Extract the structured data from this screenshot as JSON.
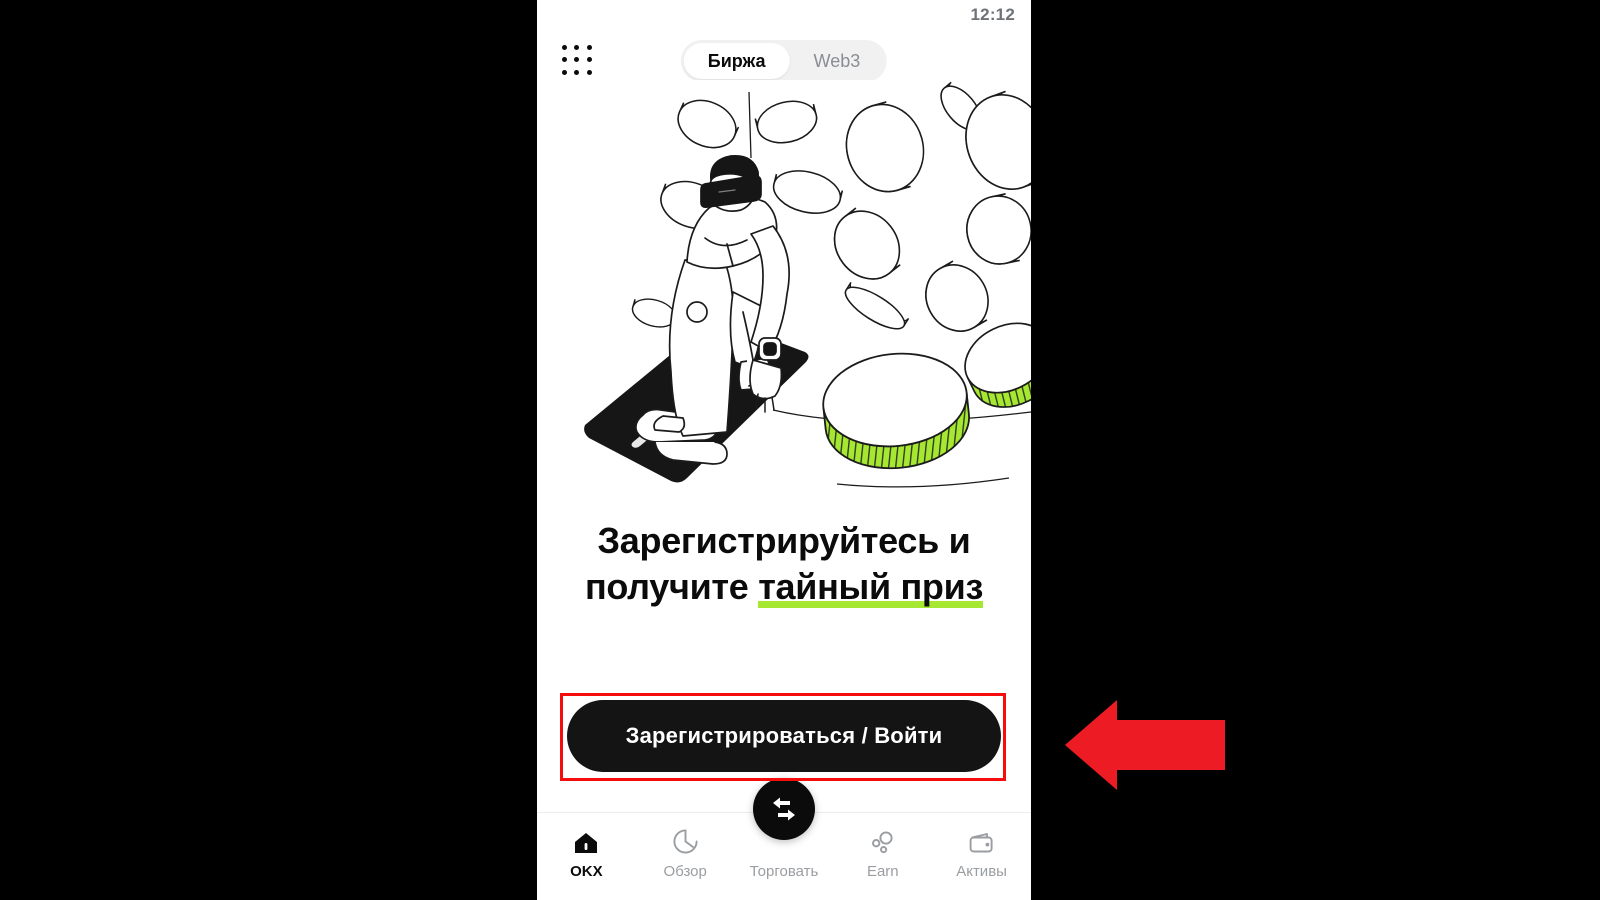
{
  "statusbar": {
    "time": "12:12"
  },
  "topbar": {
    "apps_icon": "grid-dots-icon",
    "segments": [
      {
        "label": "Биржа",
        "active": true
      },
      {
        "label": "Web3",
        "active": false
      }
    ]
  },
  "hero": {
    "illustration": "person-vr-headset-kneeling-on-phone-with-coins",
    "accent_color": "#a6e831",
    "phone_color": "#141414"
  },
  "headline": {
    "line1": "Зарегистрируйтесь и",
    "line2_plain": "получите ",
    "line2_highlight": "тайный приз",
    "highlight_color": "#a6e831"
  },
  "cta": {
    "label": "Зарегистрироваться / Войти",
    "background": "#141414",
    "text_color": "#ffffff"
  },
  "fab": {
    "icon": "swap-arrows-icon"
  },
  "tabbar": {
    "items": [
      {
        "label": "OKX",
        "icon": "home-icon",
        "active": true
      },
      {
        "label": "Обзор",
        "icon": "compass-icon",
        "active": false
      },
      {
        "label": "Торговать",
        "icon": "swap-icon",
        "active": false
      },
      {
        "label": "Earn",
        "icon": "bubbles-icon",
        "active": false
      },
      {
        "label": "Активы",
        "icon": "wallet-icon",
        "active": false
      }
    ]
  },
  "annotations": {
    "highlight_box": {
      "target": "cta",
      "color": "#f50d0d"
    },
    "pointer_arrow": {
      "direction": "left",
      "color": "#ed1c24"
    }
  }
}
